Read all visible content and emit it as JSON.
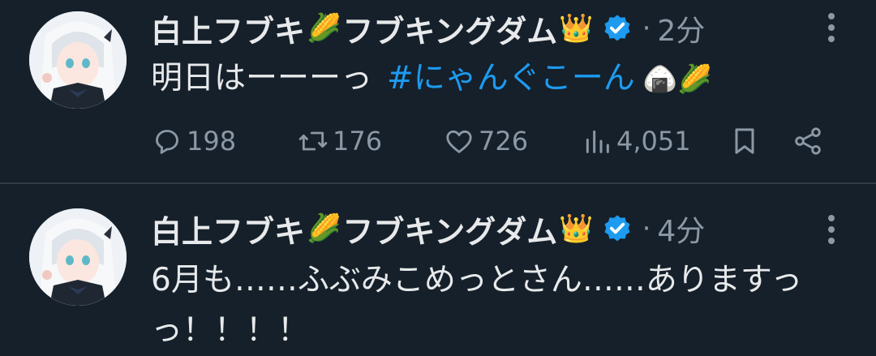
{
  "tweets": [
    {
      "author": "白上フブキ",
      "author_emoji_1": "🌽",
      "author_suffix": "フブキングダム",
      "author_emoji_2": "👑",
      "time": "2分",
      "text": "明日はーーーっ",
      "hashtag": "#にゃんぐこーん",
      "text_emoji": "🍙🌽",
      "stats": {
        "replies": "198",
        "retweets": "176",
        "likes": "726",
        "views": "4,051"
      }
    },
    {
      "author": "白上フブキ",
      "author_emoji_1": "🌽",
      "author_suffix": "フブキングダム",
      "author_emoji_2": "👑",
      "time": "4分",
      "text_line1": "6月も……ふぶみこめっとさん……ありますっ",
      "text_line2": "っ！！！！"
    }
  ],
  "separator": "·",
  "colors": {
    "background": "#15202b",
    "accent": "#1d9bf0",
    "muted": "#8b98a5",
    "verified": "#1d9bf0"
  },
  "icons": [
    "reply-icon",
    "retweet-icon",
    "like-icon",
    "views-icon",
    "bookmark-icon",
    "share-icon",
    "more-icon",
    "verified-badge-icon"
  ]
}
